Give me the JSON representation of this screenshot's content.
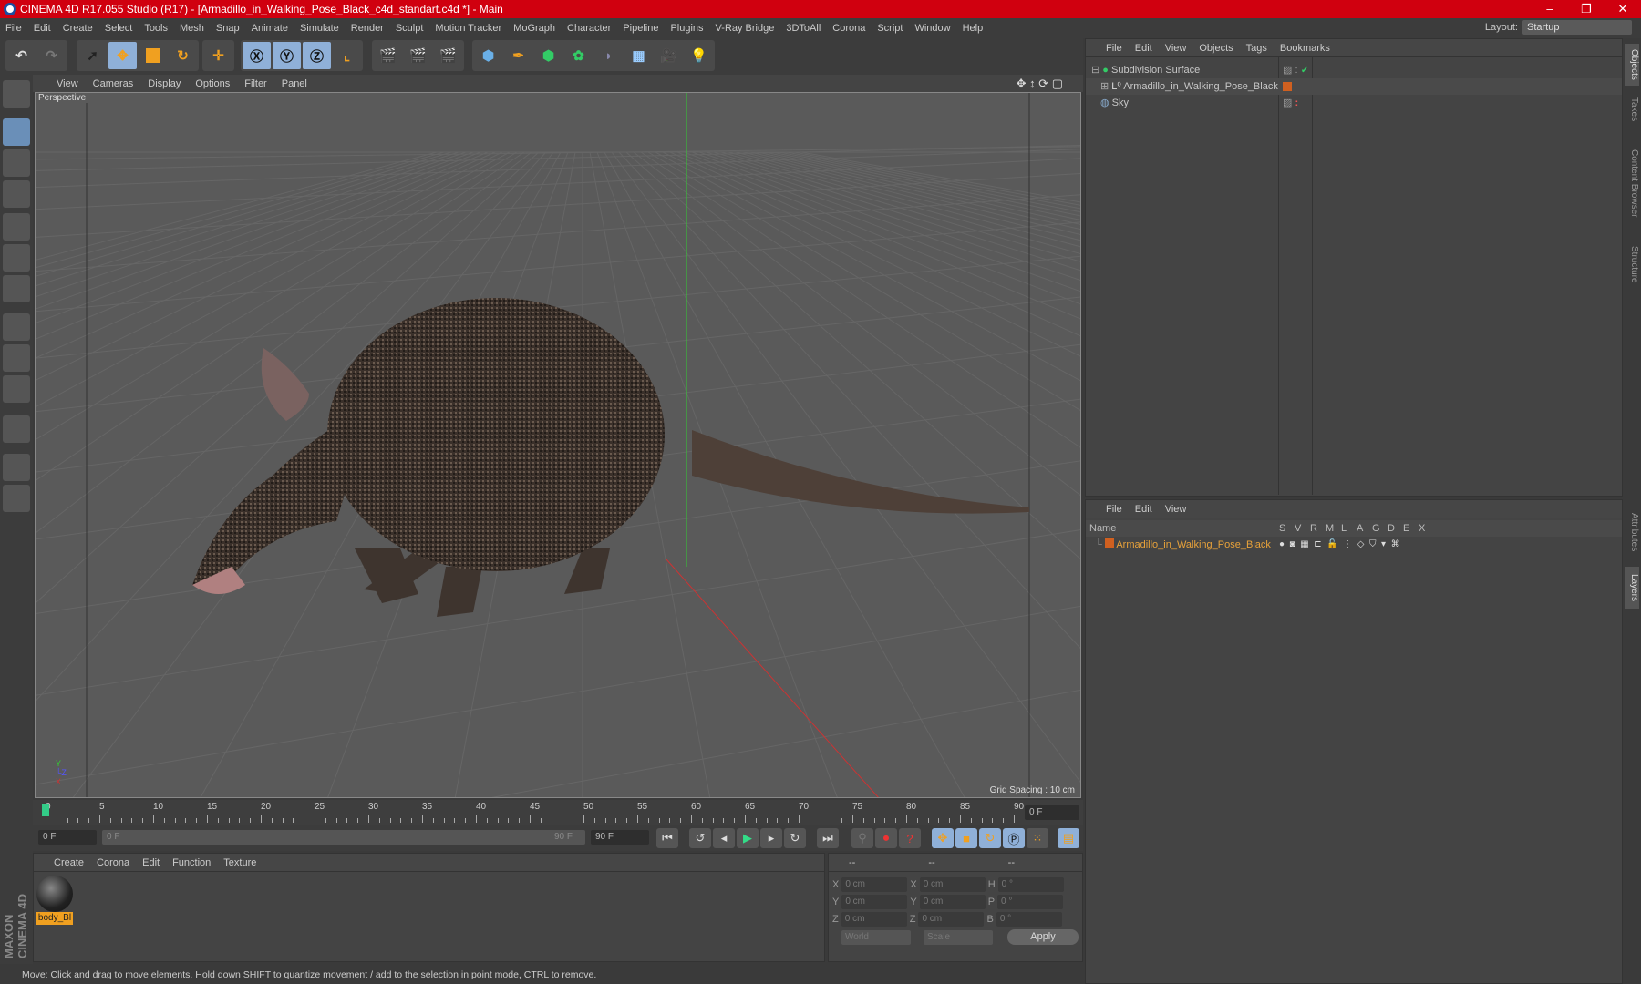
{
  "title": "CINEMA 4D R17.055 Studio (R17) - [Armadillo_in_Walking_Pose_Black_c4d_standart.c4d *] - Main",
  "menu": [
    "File",
    "Edit",
    "Create",
    "Select",
    "Tools",
    "Mesh",
    "Snap",
    "Animate",
    "Simulate",
    "Render",
    "Sculpt",
    "Motion Tracker",
    "MoGraph",
    "Character",
    "Pipeline",
    "Plugins",
    "V-Ray Bridge",
    "3DToAll",
    "Corona",
    "Script",
    "Window",
    "Help"
  ],
  "layout": {
    "label": "Layout:",
    "value": "Startup"
  },
  "viewport": {
    "menu": [
      "View",
      "Cameras",
      "Display",
      "Options",
      "Filter",
      "Panel"
    ],
    "camera": "Perspective",
    "grid_spacing": "Grid Spacing : 10 cm"
  },
  "timeline": {
    "ticks": [
      "0",
      "5",
      "10",
      "15",
      "20",
      "25",
      "30",
      "35",
      "40",
      "45",
      "50",
      "55",
      "60",
      "65",
      "70",
      "75",
      "80",
      "85",
      "90"
    ],
    "current_frame": "0 F",
    "start": "0 F",
    "range_start": "0 F",
    "range_end": "90 F",
    "end": "90 F"
  },
  "materials": {
    "menu": [
      "Create",
      "Corona",
      "Edit",
      "Function",
      "Texture"
    ],
    "items": [
      {
        "name": "body_Bl"
      }
    ]
  },
  "coords": {
    "headers": [
      "--",
      "--",
      "--"
    ],
    "rows": [
      {
        "a": "X",
        "av": "0 cm",
        "b": "X",
        "bv": "0 cm",
        "c": "H",
        "cv": "0 °"
      },
      {
        "a": "Y",
        "av": "0 cm",
        "b": "Y",
        "bv": "0 cm",
        "c": "P",
        "cv": "0 °"
      },
      {
        "a": "Z",
        "av": "0 cm",
        "b": "Z",
        "bv": "0 cm",
        "c": "B",
        "cv": "0 °"
      }
    ],
    "world": "World",
    "scale": "Scale",
    "apply": "Apply"
  },
  "status": "Move: Click and drag to move elements. Hold down SHIFT to quantize movement / add to the selection in point mode, CTRL to remove.",
  "objects": {
    "menu": [
      "File",
      "Edit",
      "View",
      "Objects",
      "Tags",
      "Bookmarks"
    ],
    "items": [
      "Subdivision Surface",
      "Armadillo_in_Walking_Pose_Black",
      "Sky"
    ]
  },
  "layers": {
    "menu": [
      "File",
      "Edit",
      "View"
    ],
    "columns": [
      "Name",
      "S",
      "V",
      "R",
      "M",
      "L",
      "A",
      "G",
      "D",
      "E",
      "X"
    ],
    "items": [
      "Armadillo_in_Walking_Pose_Black"
    ],
    "accent": "#e8a23a"
  },
  "right_tabs": [
    "Objects",
    "Takes",
    "Content Browser",
    "Structure",
    "Attributes",
    "Layers"
  ],
  "brand": "MAXON CINEMA 4D"
}
